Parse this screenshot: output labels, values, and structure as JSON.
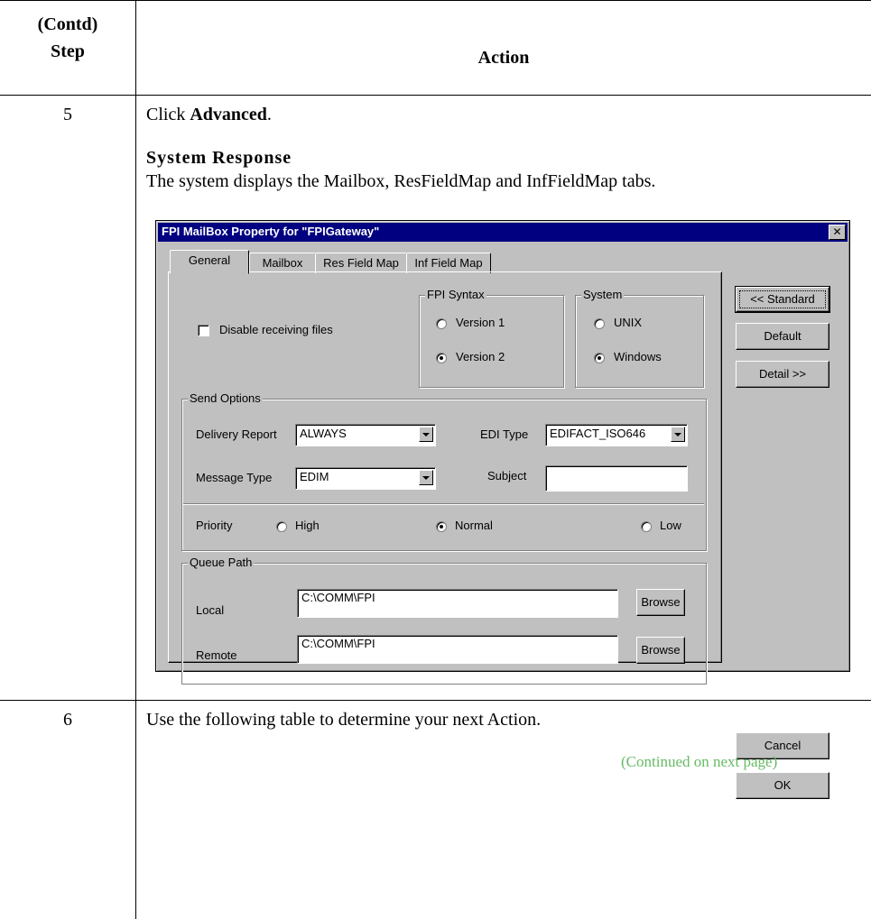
{
  "table": {
    "header_step_line1": "(Contd)",
    "header_step_line2": "Step",
    "header_action": "Action",
    "row5": {
      "step": "5",
      "instruction_prefix": "Click ",
      "instruction_bold": "Advanced",
      "instruction_suffix": ".",
      "response_heading": "System Response",
      "response_text": "The system displays the Mailbox, ResFieldMap and InfFieldMap tabs."
    },
    "row6": {
      "step": "6",
      "instruction": "Use the following table to determine your next Action.",
      "continued": "(Continued on next page)"
    },
    "continued_color": "#66bb66"
  },
  "dialog": {
    "title": "FPI MailBox Property for \"FPIGateway\"",
    "close_glyph": "✕",
    "tabs": [
      "General",
      "Mailbox",
      "Res Field Map",
      "Inf Field Map"
    ],
    "active_tab": "General",
    "disable_receiving_label": "Disable receiving files",
    "disable_receiving_checked": false,
    "fpi_syntax": {
      "label": "FPI Syntax",
      "options": [
        "Version 1",
        "Version 2"
      ],
      "selected": "Version 2"
    },
    "system": {
      "label": "System",
      "options": [
        "UNIX",
        "Windows"
      ],
      "selected": "Windows"
    },
    "send_options": {
      "label": "Send Options",
      "delivery_report_label": "Delivery Report",
      "delivery_report_value": "ALWAYS",
      "edi_type_label": "EDI Type",
      "edi_type_value": "EDIFACT_ISO646",
      "message_type_label": "Message Type",
      "message_type_value": "EDIM",
      "subject_label": "Subject",
      "subject_value": "",
      "priority_label": "Priority",
      "priority_options": [
        "High",
        "Normal",
        "Low"
      ],
      "priority_selected": "Normal"
    },
    "queue_path": {
      "label": "Queue Path",
      "local_label": "Local",
      "local_value": "C:\\COMM\\FPI",
      "remote_label": "Remote",
      "remote_value": "C:\\COMM\\FPI",
      "browse_label": "Browse"
    },
    "buttons": {
      "standard": "<< Standard",
      "default": "Default",
      "detail": "Detail >>",
      "cancel": "Cancel",
      "ok": "OK"
    },
    "colors": {
      "face": "#c0c0c0",
      "titlebar": "#000080"
    }
  }
}
